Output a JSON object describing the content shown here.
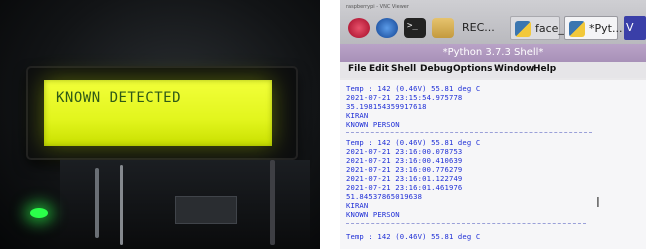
{
  "left_photo": {
    "lcd_text": "KNOWN DETECTED"
  },
  "right_photo": {
    "taskbar": {
      "title_text": "raspberrypi - VNC Viewer",
      "tasks": [
        {
          "label": "REC..."
        },
        {
          "label": "face_..."
        },
        {
          "label": "*Pyt..."
        },
        {
          "label": "V"
        }
      ]
    },
    "window_title": "*Python 3.7.3 Shell*",
    "menu": [
      "File",
      "Edit",
      "Shell",
      "Debug",
      "Options",
      "Window",
      "Help"
    ],
    "shell_lines": [
      "Temp : 142 (0.46V) 55.81 deg C",
      "2021-07-21 23:15:54.975778",
      "35.198154359917618",
      "KIRAN",
      "KNOWN PERSON",
      "Temp : 142 (0.46V) 55.81 deg C",
      "2021-07-21 23:16:00.078753",
      "2021-07-21 23:16:00.410639",
      "2021-07-21 23:16:00.776279",
      "2021-07-21 23:16:01.122749",
      "2021-07-21 23:16:01.461976",
      "51.84537865019638",
      "KIRAN",
      "KNOWN PERSON",
      "Temp : 142 (0.46V) 55.81 deg C"
    ]
  }
}
